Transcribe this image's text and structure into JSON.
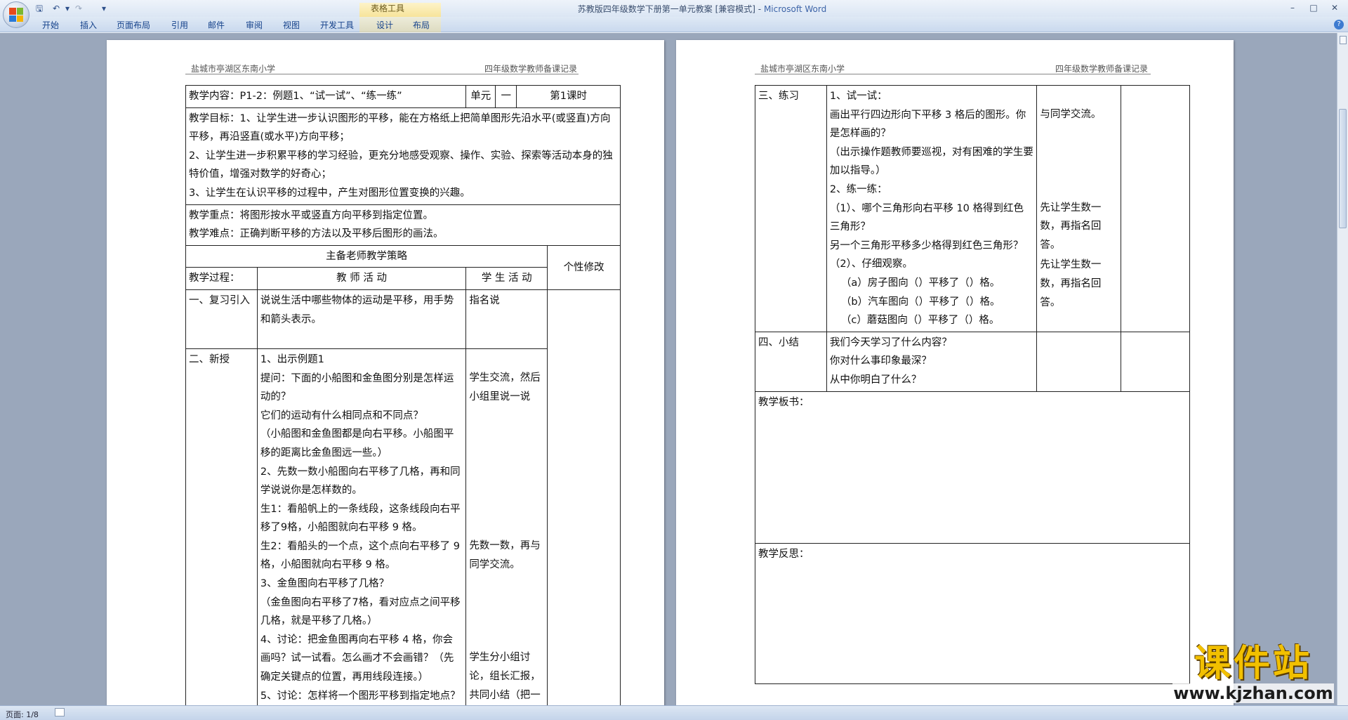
{
  "window": {
    "title": "苏教版四年级数学下册第一单元教案 [兼容模式]",
    "app_name": "Microsoft Word",
    "context_tab": "表格工具"
  },
  "ribbon": {
    "tabs": [
      "开始",
      "插入",
      "页面布局",
      "引用",
      "邮件",
      "审阅",
      "视图",
      "开发工具",
      "设计",
      "布局"
    ]
  },
  "header": {
    "school": "盐城市亭湖区东南小学",
    "record": "四年级数学教师备课记录"
  },
  "page1": {
    "content_label": "教学内容：P1-2：例题1、“试一试”、“练一练”",
    "unit_label": "单元",
    "unit_value": "一",
    "period": "第1课时",
    "goals": [
      "教学目标：1、让学生进一步认识图形的平移，能在方格纸上把简单图形先沿水平(或竖直)方向平移，再沿竖直(或水平)方向平移；",
      "2、让学生进一步积累平移的学习经验，更充分地感受观察、操作、实验、探索等活动本身的独特价值，增强对数学的好奇心；",
      "3、让学生在认识平移的过程中，产生对图形位置变换的兴趣。"
    ],
    "key_point": "教学重点：将图形按水平或竖直方向平移到指定位置。",
    "difficulty": "教学难点：正确判断平移的方法以及平移后图形的画法。",
    "strategy_header": "主备老师教学策略",
    "personal_edit": "个性修改",
    "process_label": "教学过程：",
    "teacher_activity": "教 师 活 动",
    "student_activity": "学 生 活 动",
    "review_title": "一、复习引入",
    "review_teacher": "说说生活中哪些物体的运动是平移，用手势和箭头表示。",
    "review_student": "指名说",
    "new_title": "二、新授",
    "new_teacher": [
      "1、出示例题1",
      "提问：下面的小船图和金鱼图分别是怎样运动的？",
      "它们的运动有什么相同点和不同点？",
      "（小船图和金鱼图都是向右平移。小船图平移的距离比金鱼图远一些。）",
      "2、先数一数小船图向右平移了几格，再和同学说说你是怎样数的。",
      "生1：看船帆上的一条线段，这条线段向右平移了9格，小船图就向右平移 9 格。",
      "生2：看船头的一个点，这个点向右平移了 9 格，小船图就向右平移 9 格。",
      "3、金鱼图向右平移了几格？",
      "（金鱼图向右平移了7格，看对应点之间平移几格，就是平移了几格。）",
      "4、讨论：把金鱼图再向右平移 4 格，你会画吗？试一试看。怎么画才不会画错？（先确定关键点的位置，再用线段连接。）",
      "5、讨论：怎样将一个图形平移到指定地点？"
    ],
    "new_student_1": "学生交流，然后小组里说一说",
    "new_student_2": "先数一数，再与同学交流。",
    "new_student_3": "学生分小组讨论，组长汇报，共同小结（把一个图形„„平移几格）"
  },
  "page2": {
    "practice_title": "三、练习",
    "practice_teacher": [
      "1、试一试：",
      "画出平行四边形向下平移 3 格后的图形。你是怎样画的？",
      "（出示操作题教师要巡视，对有困难的学生要加以指导。）",
      "2、练一练：",
      "（1）、哪个三角形向右平移 10 格得到红色三角形？",
      "另一个三角形平移多少格得到红色三角形？",
      "（2）、仔细观察。",
      "（a）房子图向（）平移了（）格。",
      "（b）汽车图向（）平移了（）格。",
      "（c）蘑菇图向（）平移了（）格。"
    ],
    "practice_student_1": "与同学交流。",
    "practice_student_2": "先让学生数一数，再指名回答。",
    "practice_student_3": "先让学生数一数，再指名回答。",
    "summary_title": "四、小结",
    "summary_teacher": [
      "我们今天学习了什么内容？",
      "你对什么事印象最深？",
      "从中你明白了什么？"
    ],
    "board_label": "教学板书：",
    "reflection_label": "教学反思："
  },
  "status": {
    "page_info": "页面: 1/8"
  },
  "watermark": {
    "brand": "课件站",
    "url": "www.kjzhan.com"
  },
  "colors": {
    "ribbon_blue": "#15428b",
    "context_yellow": "#f7e49a",
    "watermark_gold": "#f2c000"
  }
}
